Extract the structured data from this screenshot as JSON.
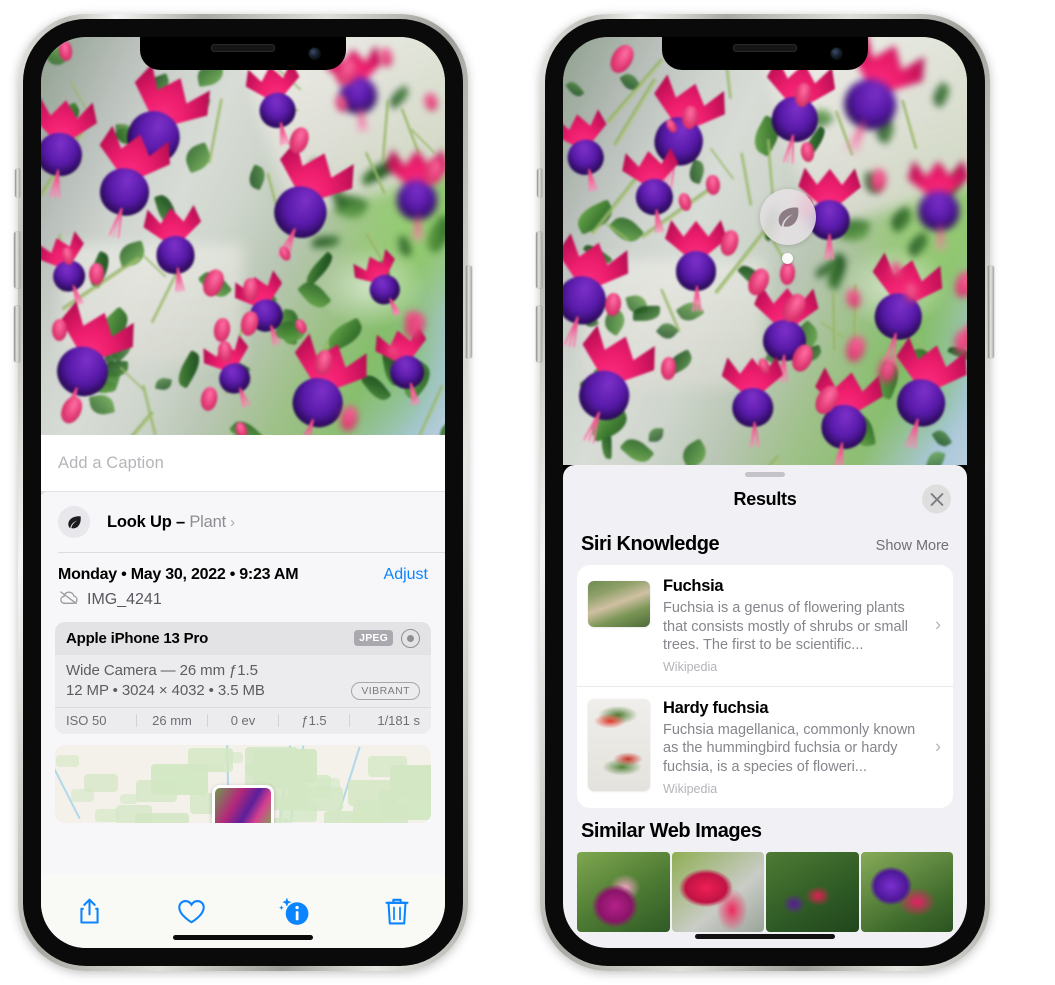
{
  "left_phone": {
    "caption_field": {
      "placeholder": "Add a Caption",
      "value": ""
    },
    "lookup_row": {
      "icon": "leaf-icon",
      "sparkle_icon": "sparkles-icon",
      "label": "Look Up –",
      "subject": "Plant",
      "chevron": "›"
    },
    "meta": {
      "date": "Monday • May 30, 2022 • 9:23 AM",
      "adjust_label": "Adjust",
      "cloud_icon": "icloud-slash-icon",
      "filename": "IMG_4241"
    },
    "camera_card": {
      "model": "Apple iPhone 13 Pro",
      "format_badge": "JPEG",
      "aperture_icon": "aperture-icon",
      "lens_line": "Wide Camera — 26 mm ƒ1.5",
      "specs_line": "12 MP • 3024 × 4032 • 3.5 MB",
      "style_badge": "VIBRANT",
      "exif": [
        "ISO 50",
        "26 mm",
        "0 ev",
        "ƒ1.5",
        "1/181 s"
      ]
    },
    "map_card": {
      "name": "location-map-thumbnail"
    },
    "toolbar": [
      {
        "name": "share-button",
        "icon": "share-icon"
      },
      {
        "name": "favorite-button",
        "icon": "heart-icon"
      },
      {
        "name": "info-button",
        "icon": "info-sparkle-icon"
      },
      {
        "name": "delete-button",
        "icon": "trash-icon"
      }
    ],
    "accent_color": "#0a84ff"
  },
  "right_phone": {
    "visual_lookup_badge": {
      "icon": "leaf-icon",
      "name": "visual-lookup-badge"
    },
    "sheet": {
      "title": "Results",
      "close_icon": "close-icon",
      "sections": [
        {
          "title": "Siri Knowledge",
          "action": "Show More",
          "cards": [
            {
              "title": "Fuchsia",
              "description": "Fuchsia is a genus of flowering plants that consists mostly of shrubs or small trees. The first to be scientific...",
              "source": "Wikipedia",
              "chevron": "›"
            },
            {
              "title": "Hardy fuchsia",
              "description": "Fuchsia magellanica, commonly known as the hummingbird fuchsia or hardy fuchsia, is a species of floweri...",
              "source": "Wikipedia",
              "chevron": "›"
            }
          ]
        },
        {
          "title": "Similar Web Images",
          "images": [
            {
              "name": "similar-image-1"
            },
            {
              "name": "similar-image-2"
            },
            {
              "name": "similar-image-3"
            },
            {
              "name": "similar-image-4"
            }
          ]
        }
      ]
    }
  }
}
